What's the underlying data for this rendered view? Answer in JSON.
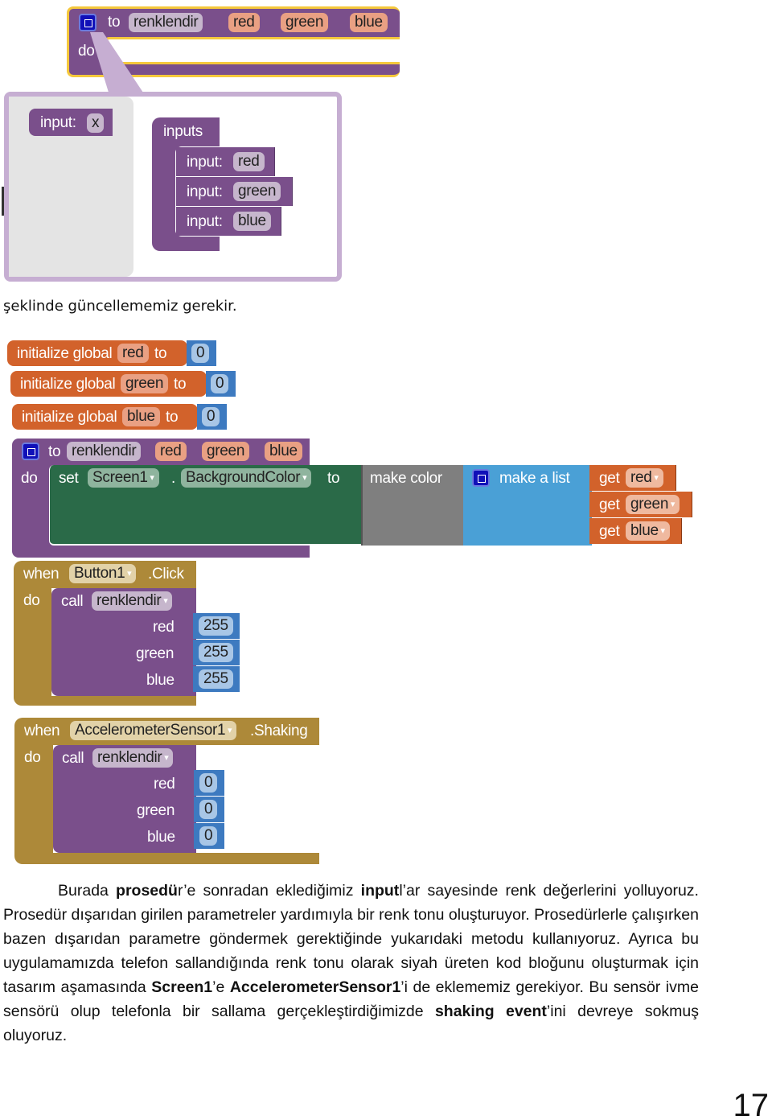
{
  "figure1": {
    "proc_header": {
      "to_label": "to",
      "name": "renklendir",
      "params": [
        "red",
        "green",
        "blue"
      ],
      "do_label": "do"
    },
    "mutator_panel": {
      "left_block": {
        "label": "input:",
        "value": "x"
      },
      "container": {
        "label": "inputs",
        "items": [
          {
            "label": "input:",
            "value": "red"
          },
          {
            "label": "input:",
            "value": "green"
          },
          {
            "label": "input:",
            "value": "blue"
          }
        ]
      }
    }
  },
  "caption1": "şeklinde güncellememiz gerekir.",
  "figure2": {
    "globals": [
      {
        "prefix": "initialize global",
        "name": "red",
        "to_label": "to",
        "value": "0"
      },
      {
        "prefix": "initialize global",
        "name": "green",
        "to_label": "to",
        "value": "0"
      },
      {
        "prefix": "initialize global",
        "name": "blue",
        "to_label": "to",
        "value": "0"
      }
    ],
    "procedure": {
      "to_label": "to",
      "name": "renklendir",
      "params": [
        "red",
        "green",
        "blue"
      ],
      "do_label": "do",
      "set_label": "set",
      "component": "Screen1",
      "dot": ".",
      "property": "BackgroundColor",
      "set_to_label": "to",
      "make_color_label": "make color",
      "make_list_label": "make a list",
      "gets": [
        {
          "label": "get",
          "var": "red"
        },
        {
          "label": "get",
          "var": "green"
        },
        {
          "label": "get",
          "var": "blue"
        }
      ]
    },
    "events": [
      {
        "when_label": "when",
        "component": "Button1",
        "event": ".Click",
        "do_label": "do",
        "call_label": "call",
        "proc": "renklendir",
        "args": [
          {
            "name": "red",
            "value": "255"
          },
          {
            "name": "green",
            "value": "255"
          },
          {
            "name": "blue",
            "value": "255"
          }
        ]
      },
      {
        "when_label": "when",
        "component": "AccelerometerSensor1",
        "event": ".Shaking",
        "do_label": "do",
        "call_label": "call",
        "proc": "renklendir",
        "args": [
          {
            "name": "red",
            "value": "0"
          },
          {
            "name": "green",
            "value": "0"
          },
          {
            "name": "blue",
            "value": "0"
          }
        ]
      }
    ]
  },
  "paragraph": {
    "segments": [
      {
        "text": "Burada ",
        "bold": false
      },
      {
        "text": "prosedü",
        "bold": true
      },
      {
        "text": "r’e sonradan eklediğimiz ",
        "bold": false
      },
      {
        "text": "input",
        "bold": true
      },
      {
        "text": "l’ar sayesinde renk değerlerini yolluyoruz. Prosedür dışarıdan girilen parametreler yardımıyla bir renk tonu oluşturuyor. Prosedürlerle çalışırken bazen dışarıdan parametre göndermek gerektiğinde yukarıdaki metodu kullanıyoruz. Ayrıca bu uygulamamızda telefon sallandığında renk tonu olarak siyah üreten  kod bloğunu oluşturmak için tasarım aşamasında ",
        "bold": false
      },
      {
        "text": "Screen1",
        "bold": true
      },
      {
        "text": "’e ",
        "bold": false
      },
      {
        "text": "AccelerometerSensor1",
        "bold": true
      },
      {
        "text": "’i de eklememiz gerekiyor. Bu sensör ivme sensörü olup telefonla bir sallama gerçekleştirdiğimizde ",
        "bold": false
      },
      {
        "text": "shaking event",
        "bold": true
      },
      {
        "text": "’ini devreye sokmuş oluyoruz.",
        "bold": false
      }
    ]
  },
  "page_number": "17",
  "colors": {
    "procedure": "#7a4f8b",
    "variable": "#d2622b",
    "event": "#ad8939",
    "setter": "#2a6a48",
    "color": "#7f7f7f",
    "list": "#4aa0d6",
    "number": "#3d7ac0",
    "selection": "#f5c83c"
  }
}
